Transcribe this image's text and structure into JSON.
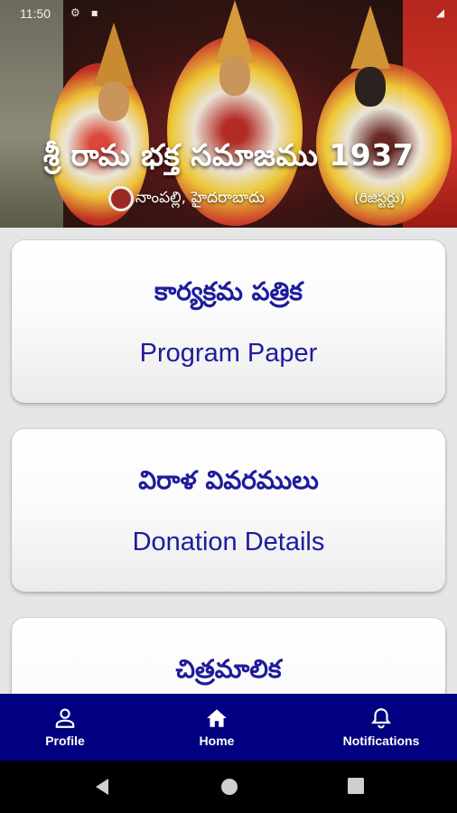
{
  "status_bar": {
    "time": "11:50"
  },
  "banner": {
    "title": "శ్రీ రామ భక్త సమాజము 1937",
    "subtitle": "నాంపల్లి, హైదరాబాదు",
    "registered": "(రిజిస్టర్డు)"
  },
  "cards": [
    {
      "telugu": "కార్యక్రమ పత్రిక",
      "english": "Program Paper"
    },
    {
      "telugu": "విరాళ వివరములు",
      "english": "Donation Details"
    },
    {
      "telugu": "చిత్రమాలిక",
      "english": ""
    }
  ],
  "bottom_nav": {
    "profile": "Profile",
    "home": "Home",
    "notifications": "Notifications"
  },
  "colors": {
    "accent": "#000080",
    "card_text": "#1d1c9c"
  }
}
